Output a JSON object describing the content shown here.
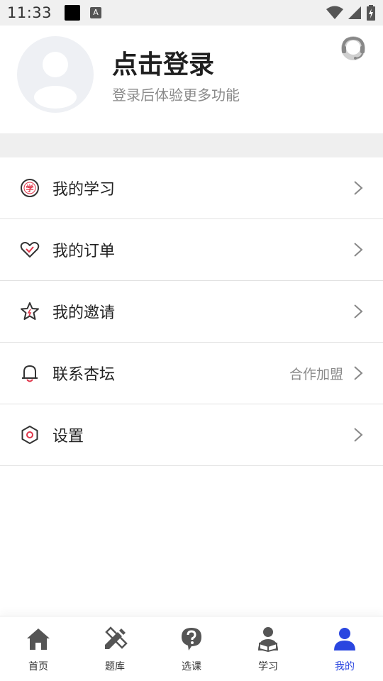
{
  "status_bar": {
    "time": "11:33",
    "a_glyph": "A"
  },
  "profile": {
    "title": "点击登录",
    "subtitle": "登录后体验更多功能",
    "avatar_icon": "user-placeholder-icon",
    "service_icon": "customer-service-icon"
  },
  "menu": {
    "items": [
      {
        "label": "我的学习",
        "icon": "study-icon",
        "extra": ""
      },
      {
        "label": "我的订单",
        "icon": "heart-check-icon",
        "extra": ""
      },
      {
        "label": "我的邀请",
        "icon": "star-icon",
        "extra": ""
      },
      {
        "label": "联系杏坛",
        "icon": "bell-icon",
        "extra": "合作加盟"
      },
      {
        "label": "设置",
        "icon": "hexagon-settings-icon",
        "extra": ""
      }
    ],
    "study_glyph": "学"
  },
  "bottom_nav": {
    "items": [
      {
        "label": "首页",
        "icon": "home-icon"
      },
      {
        "label": "题库",
        "icon": "pencil-ruler-icon"
      },
      {
        "label": "选课",
        "icon": "question-icon"
      },
      {
        "label": "学习",
        "icon": "learner-icon"
      },
      {
        "label": "我的",
        "icon": "profile-icon"
      }
    ],
    "active_index": 4
  },
  "colors": {
    "accent": "#2a46e0",
    "icon_red": "#e0364a",
    "icon_dark": "#333333",
    "divider_band": "#efefef"
  }
}
